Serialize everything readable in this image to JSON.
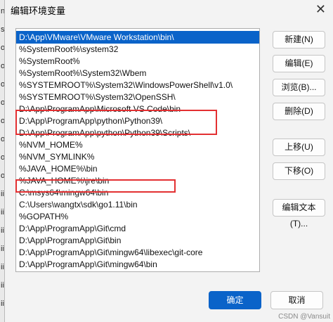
{
  "window": {
    "title": "编辑环境变量",
    "close_glyph": "✕"
  },
  "background_fragments": [
    "nc",
    "ss",
    "o",
    "o",
    "o",
    "o",
    "o",
    "o",
    "o",
    "o",
    "ii",
    "ii",
    "ii",
    "ii",
    "ii",
    "ii",
    "ii"
  ],
  "path_entries": [
    "D:\\App\\VMware\\VMware Workstation\\bin\\",
    "%SystemRoot%\\system32",
    "%SystemRoot%",
    "%SystemRoot%\\System32\\Wbem",
    "%SYSTEMROOT%\\System32\\WindowsPowerShell\\v1.0\\",
    "%SYSTEMROOT%\\System32\\OpenSSH\\",
    "D:\\App\\ProgramApp\\Microsoft VS Code\\bin",
    "D:\\App\\ProgramApp\\python\\Python39\\",
    "D:\\App\\ProgramApp\\python\\Python39\\Scripts\\",
    "%NVM_HOME%",
    "%NVM_SYMLINK%",
    "%JAVA_HOME%\\bin",
    "%JAVA_HOME%\\jre\\bin",
    "C:\\msys64\\mingw64\\bin",
    "C:\\Users\\wangtx\\sdk\\go1.11\\bin",
    "%GOPATH%",
    "D:\\App\\ProgramApp\\Git\\cmd",
    "D:\\App\\ProgramApp\\Git\\bin",
    "D:\\App\\ProgramApp\\Git\\mingw64\\libexec\\git-core",
    "D:\\App\\ProgramApp\\Git\\mingw64\\bin"
  ],
  "selected_index": 0,
  "buttons": {
    "new": "新建(N)",
    "edit": "编辑(E)",
    "browse": "浏览(B)...",
    "delete": "删除(D)",
    "move_up": "上移(U)",
    "move_down": "下移(O)",
    "edit_text": "编辑文本(T)...",
    "ok": "确定",
    "cancel": "取消"
  },
  "watermark": "CSDN @Vansuit"
}
